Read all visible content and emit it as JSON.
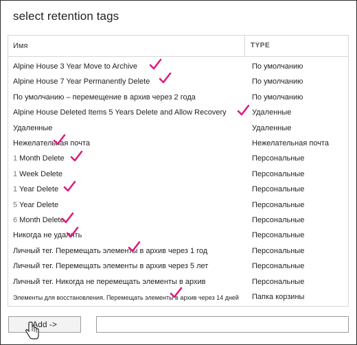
{
  "dialog": {
    "title": "select retention tags"
  },
  "table": {
    "headers": {
      "name": "Имя",
      "type": "TYPE"
    },
    "rows": [
      {
        "name": "Alpine House 3 Year Move to Archive",
        "type": "По умолчанию"
      },
      {
        "name": "Alpine House 7 Year Permanently Delete",
        "type": "По умолчанию"
      },
      {
        "name": "По умолчанию – перемещение в архив через 2 года",
        "type": "По умолчанию"
      },
      {
        "name": "Alpine House Deleted Items 5 Years Delete and Allow Recovery",
        "type": "Удаленные"
      },
      {
        "name": "Удаленные",
        "type": "Удаленные"
      },
      {
        "name": "Нежелательная почта",
        "type": "Нежелательная почта"
      },
      {
        "num": "1",
        "name": " Month Delete",
        "type": "Персональные"
      },
      {
        "num": "1",
        "name": " Week Delete",
        "type": "Персональные"
      },
      {
        "num": "1",
        "name": " Year Delete",
        "type": "Персональные"
      },
      {
        "num": "5",
        "name": " Year Delete",
        "type": "Персональные"
      },
      {
        "num": "6",
        "name": " Month Delete",
        "type": "Персональные"
      },
      {
        "name": "Никогда не удалять",
        "type": "Персональные"
      },
      {
        "name": "Личный тег. Перемещать элементы в архив через 1 год",
        "type": "Персональные"
      },
      {
        "name": "Личный тег. Перемещать элементы в архив через 5 лет",
        "type": "Персональные"
      },
      {
        "name": "Личный тег. Никогда не перемещать элементы в архив",
        "type": "Персональные"
      },
      {
        "name": "Элементы для восстановления. Перемещать элементы в архив через 14 дней",
        "type": "Папка корзины"
      }
    ]
  },
  "footer": {
    "add_label": "Add ->",
    "add_field_value": ""
  },
  "colors": {
    "checkmark": "#e0197d",
    "border": "#d7d7d7"
  },
  "icons": {
    "checkmark": "checkmark-icon",
    "cursor": "hand-cursor-icon"
  }
}
